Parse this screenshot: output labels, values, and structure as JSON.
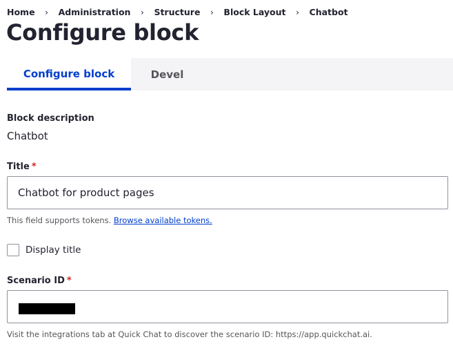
{
  "breadcrumb": {
    "items": [
      "Home",
      "Administration",
      "Structure",
      "Block Layout",
      "Chatbot"
    ],
    "separator": "›"
  },
  "page_title": "Configure block",
  "tabs": [
    {
      "label": "Configure block",
      "active": true
    },
    {
      "label": "Devel",
      "active": false
    }
  ],
  "block_description": {
    "label": "Block description",
    "value": "Chatbot"
  },
  "title_field": {
    "label": "Title",
    "required_marker": "*",
    "value": "Chatbot for product pages",
    "description_prefix": "This field supports tokens. ",
    "description_link": "Browse available tokens."
  },
  "display_title": {
    "label": "Display title",
    "checked": false
  },
  "scenario_field": {
    "label": "Scenario ID",
    "required_marker": "*",
    "value_redacted": true,
    "description": "Visit the integrations tab at Quick Chat to discover the scenario ID: https://app.quickchat.ai."
  },
  "colors": {
    "accent": "#003ecc",
    "required": "#dc2323",
    "text": "#222330"
  }
}
